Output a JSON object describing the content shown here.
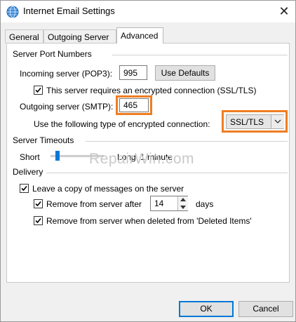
{
  "window": {
    "title": "Internet Email Settings",
    "close_label": "✕"
  },
  "tabs": [
    {
      "label": "General",
      "active": false
    },
    {
      "label": "Outgoing Server",
      "active": false
    },
    {
      "label": "Advanced",
      "active": true
    }
  ],
  "server_ports": {
    "group_label": "Server Port Numbers",
    "incoming_label": "Incoming server (POP3):",
    "incoming_value": "995",
    "use_defaults_label": "Use Defaults",
    "encrypted_label": "This server requires an encrypted connection (SSL/TLS)",
    "encrypted_checked": true,
    "outgoing_label": "Outgoing server (SMTP):",
    "outgoing_value": "465",
    "encryption_type_label": "Use the following type of encrypted connection:",
    "encryption_type_value": "SSL/TLS"
  },
  "server_timeouts": {
    "group_label": "Server Timeouts",
    "short_label": "Short",
    "long_label": "Long",
    "value_label": "1 minute",
    "slider_level": 0.1
  },
  "delivery": {
    "group_label": "Delivery",
    "leave_copy_label": "Leave a copy of messages on the server",
    "leave_copy_checked": true,
    "remove_after_label": "Remove from server after",
    "remove_after_checked": true,
    "remove_after_value": "14",
    "days_label": "days",
    "remove_deleted_label": "Remove from server when deleted from 'Deleted Items'",
    "remove_deleted_checked": true
  },
  "footer": {
    "ok_label": "OK",
    "cancel_label": "Cancel"
  },
  "watermark": "RepairWin.com",
  "colors": {
    "highlight": "#ef7d22",
    "focus_blue": "#0078d7"
  }
}
